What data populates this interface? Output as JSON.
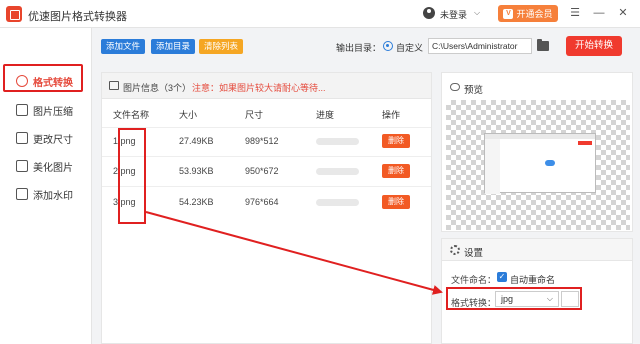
{
  "app": {
    "title": "优速图片格式转换器"
  },
  "header": {
    "login": "未登录",
    "vip_icon": "V",
    "vip": "开通会员",
    "win_controls": [
      "☰",
      "—",
      "✕"
    ]
  },
  "sidebar": {
    "items": [
      {
        "label": "格式转换",
        "active": true
      },
      {
        "label": "图片压缩"
      },
      {
        "label": "更改尺寸"
      },
      {
        "label": "美化图片"
      },
      {
        "label": "添加水印"
      }
    ]
  },
  "toolbar": {
    "add_file": "添加文件",
    "add_dir": "添加目录",
    "clear": "清除列表",
    "output_label": "输出目录：",
    "custom": "自定义",
    "path": "C:\\Users\\Administrator",
    "start": "开始转换"
  },
  "file_list": {
    "title": "图片信息（3个）",
    "note": "注意：如果图片较大请耐心等待...",
    "columns": [
      "文件名称",
      "大小",
      "尺寸",
      "进度",
      "操作"
    ],
    "rows": [
      {
        "name": "1.png",
        "size": "27.49KB",
        "dims": "989*512",
        "progress": 0,
        "action": "删除"
      },
      {
        "name": "2.png",
        "size": "53.93KB",
        "dims": "950*672",
        "progress": 0,
        "action": "删除"
      },
      {
        "name": "3.png",
        "size": "54.23KB",
        "dims": "976*664",
        "progress": 0,
        "action": "删除"
      }
    ]
  },
  "preview": {
    "title": "预览"
  },
  "settings": {
    "title": "设置",
    "naming_label": "文件命名：",
    "auto_rename": "自动重命名",
    "auto_rename_checked": true,
    "format_label": "格式转换：",
    "format_value": "jpg"
  },
  "colors": {
    "accent_red": "#f03a2e",
    "vip_orange": "#f6803b",
    "blue_button": "#2b7cd9",
    "clear_button": "#f5a623",
    "annotation_red": "#e02020"
  }
}
